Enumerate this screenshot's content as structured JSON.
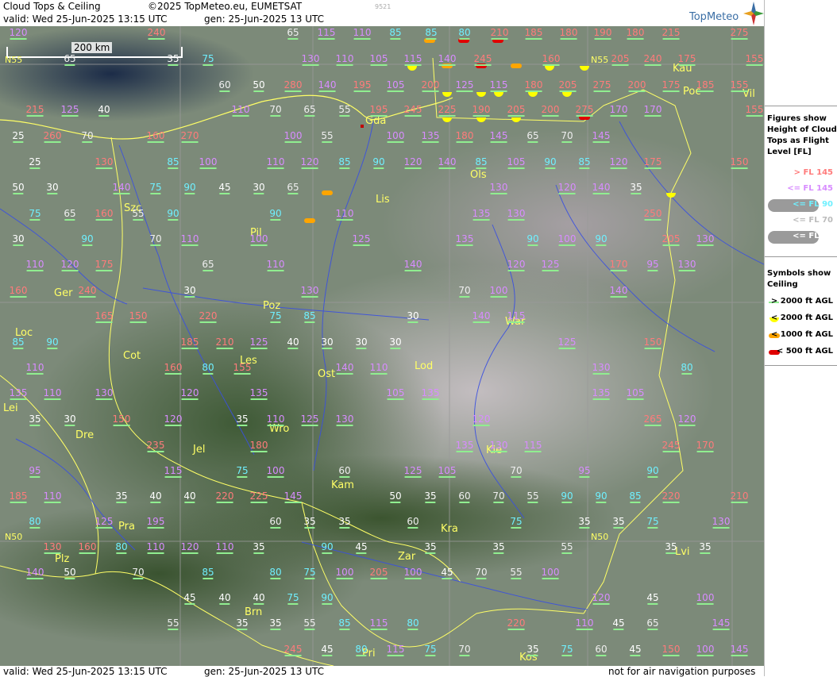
{
  "header": {
    "title": "Cloud Tops & Ceiling",
    "copyright": "©2025 TopMeteo.eu, EUMETSAT",
    "image_number": "9521",
    "valid": "valid:  Wed  25-Jun-2025  13:15 UTC",
    "generated": "gen:  25-Jun-2025 13 UTC",
    "logo": "TopMeteo"
  },
  "footer": {
    "valid": "valid:  Wed  25-Jun-2025  13:15 UTC",
    "generated": "gen:  25-Jun-2025 13 UTC",
    "disclaimer": "not for air navigation purposes"
  },
  "scale_bar": "200 km",
  "grid_labels": [
    "N55",
    "N55",
    "N50",
    "N50"
  ],
  "cities": [
    "Gda",
    "Kau",
    "Poc",
    "Vil",
    "Szc",
    "Ols",
    "Lis",
    "Pil",
    "Ger",
    "Poz",
    "War",
    "Loc",
    "Cot",
    "Les",
    "Ost",
    "Lod",
    "Lei",
    "Dre",
    "Wro",
    "Jel",
    "Kie",
    "Kam",
    "Pra",
    "Kra",
    "Zar",
    "Plz",
    "Lvi",
    "Brn",
    "Pri",
    "Kos"
  ],
  "flight_levels": [
    {
      "v": "120",
      "c": "mid"
    },
    {
      "v": "240",
      "c": "hi"
    },
    {
      "v": "65",
      "c": "vlo"
    },
    {
      "v": "115",
      "c": "mid"
    },
    {
      "v": "110",
      "c": "mid"
    },
    {
      "v": "85",
      "c": "lo"
    },
    {
      "v": "85",
      "c": "lo"
    },
    {
      "v": "80",
      "c": "lo"
    },
    {
      "v": "210",
      "c": "hi"
    },
    {
      "v": "185",
      "c": "hi"
    },
    {
      "v": "180",
      "c": "hi"
    },
    {
      "v": "190",
      "c": "hi"
    },
    {
      "v": "180",
      "c": "hi"
    },
    {
      "v": "215",
      "c": "hi"
    },
    {
      "v": "275",
      "c": "hi"
    },
    {
      "v": "65",
      "c": "vlo"
    },
    {
      "v": "35",
      "c": "min"
    },
    {
      "v": "75",
      "c": "lo"
    },
    {
      "v": "130",
      "c": "mid"
    },
    {
      "v": "110",
      "c": "mid"
    },
    {
      "v": "105",
      "c": "mid"
    },
    {
      "v": "115",
      "c": "mid"
    },
    {
      "v": "140",
      "c": "mid"
    },
    {
      "v": "245",
      "c": "hi"
    },
    {
      "v": "160",
      "c": "hi"
    },
    {
      "v": "205",
      "c": "hi"
    },
    {
      "v": "240",
      "c": "hi"
    },
    {
      "v": "175",
      "c": "hi"
    },
    {
      "v": "155",
      "c": "hi"
    },
    {
      "v": "60",
      "c": "vlo"
    },
    {
      "v": "50",
      "c": "min"
    },
    {
      "v": "280",
      "c": "hi"
    },
    {
      "v": "140",
      "c": "mid"
    },
    {
      "v": "195",
      "c": "hi"
    },
    {
      "v": "105",
      "c": "mid"
    },
    {
      "v": "200",
      "c": "hi"
    },
    {
      "v": "125",
      "c": "mid"
    },
    {
      "v": "115",
      "c": "mid"
    },
    {
      "v": "180",
      "c": "hi"
    },
    {
      "v": "205",
      "c": "hi"
    },
    {
      "v": "275",
      "c": "hi"
    },
    {
      "v": "200",
      "c": "hi"
    },
    {
      "v": "175",
      "c": "hi"
    },
    {
      "v": "185",
      "c": "hi"
    },
    {
      "v": "155",
      "c": "hi"
    },
    {
      "v": "215",
      "c": "hi"
    },
    {
      "v": "125",
      "c": "mid"
    },
    {
      "v": "40",
      "c": "min"
    },
    {
      "v": "110",
      "c": "mid"
    },
    {
      "v": "70",
      "c": "vlo"
    },
    {
      "v": "65",
      "c": "vlo"
    },
    {
      "v": "55",
      "c": "vlo"
    },
    {
      "v": "195",
      "c": "hi"
    },
    {
      "v": "245",
      "c": "hi"
    },
    {
      "v": "225",
      "c": "hi"
    },
    {
      "v": "190",
      "c": "hi"
    },
    {
      "v": "205",
      "c": "hi"
    },
    {
      "v": "200",
      "c": "hi"
    },
    {
      "v": "275",
      "c": "hi"
    },
    {
      "v": "170",
      "c": "mid"
    },
    {
      "v": "170",
      "c": "mid"
    },
    {
      "v": "155",
      "c": "hi"
    },
    {
      "v": "25",
      "c": "min"
    },
    {
      "v": "260",
      "c": "hi"
    },
    {
      "v": "70",
      "c": "vlo"
    },
    {
      "v": "160",
      "c": "hi"
    },
    {
      "v": "270",
      "c": "hi"
    },
    {
      "v": "100",
      "c": "mid"
    },
    {
      "v": "55",
      "c": "vlo"
    },
    {
      "v": "100",
      "c": "mid"
    },
    {
      "v": "135",
      "c": "mid"
    },
    {
      "v": "180",
      "c": "hi"
    },
    {
      "v": "145",
      "c": "mid"
    },
    {
      "v": "65",
      "c": "vlo"
    },
    {
      "v": "70",
      "c": "vlo"
    },
    {
      "v": "145",
      "c": "mid"
    },
    {
      "v": "25",
      "c": "min"
    },
    {
      "v": "130",
      "c": "hi"
    },
    {
      "v": "85",
      "c": "lo"
    },
    {
      "v": "100",
      "c": "mid"
    },
    {
      "v": "110",
      "c": "mid"
    },
    {
      "v": "120",
      "c": "mid"
    },
    {
      "v": "85",
      "c": "lo"
    },
    {
      "v": "90",
      "c": "lo"
    },
    {
      "v": "120",
      "c": "mid"
    },
    {
      "v": "140",
      "c": "mid"
    },
    {
      "v": "85",
      "c": "lo"
    },
    {
      "v": "105",
      "c": "mid"
    },
    {
      "v": "90",
      "c": "lo"
    },
    {
      "v": "85",
      "c": "lo"
    },
    {
      "v": "120",
      "c": "mid"
    },
    {
      "v": "175",
      "c": "hi"
    },
    {
      "v": "150",
      "c": "hi"
    },
    {
      "v": "50",
      "c": "min"
    },
    {
      "v": "30",
      "c": "min"
    },
    {
      "v": "140",
      "c": "mid"
    },
    {
      "v": "75",
      "c": "lo"
    },
    {
      "v": "90",
      "c": "lo"
    },
    {
      "v": "45",
      "c": "min"
    },
    {
      "v": "30",
      "c": "min"
    },
    {
      "v": "65",
      "c": "vlo"
    },
    {
      "v": "130",
      "c": "mid"
    },
    {
      "v": "120",
      "c": "mid"
    },
    {
      "v": "140",
      "c": "mid"
    },
    {
      "v": "35",
      "c": "min"
    },
    {
      "v": "75",
      "c": "lo"
    },
    {
      "v": "65",
      "c": "vlo"
    },
    {
      "v": "160",
      "c": "hi"
    },
    {
      "v": "55",
      "c": "vlo"
    },
    {
      "v": "90",
      "c": "lo"
    },
    {
      "v": "90",
      "c": "lo"
    },
    {
      "v": "110",
      "c": "mid"
    },
    {
      "v": "135",
      "c": "mid"
    },
    {
      "v": "130",
      "c": "mid"
    },
    {
      "v": "250",
      "c": "hi"
    },
    {
      "v": "30",
      "c": "min"
    },
    {
      "v": "90",
      "c": "lo"
    },
    {
      "v": "70",
      "c": "vlo"
    },
    {
      "v": "110",
      "c": "mid"
    },
    {
      "v": "100",
      "c": "mid"
    },
    {
      "v": "125",
      "c": "mid"
    },
    {
      "v": "135",
      "c": "mid"
    },
    {
      "v": "90",
      "c": "lo"
    },
    {
      "v": "100",
      "c": "mid"
    },
    {
      "v": "90",
      "c": "lo"
    },
    {
      "v": "205",
      "c": "hi"
    },
    {
      "v": "130",
      "c": "mid"
    },
    {
      "v": "110",
      "c": "mid"
    },
    {
      "v": "120",
      "c": "mid"
    },
    {
      "v": "175",
      "c": "hi"
    },
    {
      "v": "65",
      "c": "vlo"
    },
    {
      "v": "110",
      "c": "mid"
    },
    {
      "v": "140",
      "c": "mid"
    },
    {
      "v": "120",
      "c": "mid"
    },
    {
      "v": "125",
      "c": "mid"
    },
    {
      "v": "170",
      "c": "hi"
    },
    {
      "v": "95",
      "c": "mid"
    },
    {
      "v": "130",
      "c": "mid"
    },
    {
      "v": "160",
      "c": "hi"
    },
    {
      "v": "240",
      "c": "hi"
    },
    {
      "v": "30",
      "c": "min"
    },
    {
      "v": "130",
      "c": "mid"
    },
    {
      "v": "70",
      "c": "vlo"
    },
    {
      "v": "100",
      "c": "mid"
    },
    {
      "v": "140",
      "c": "mid"
    },
    {
      "v": "165",
      "c": "hi"
    },
    {
      "v": "150",
      "c": "hi"
    },
    {
      "v": "220",
      "c": "hi"
    },
    {
      "v": "75",
      "c": "lo"
    },
    {
      "v": "85",
      "c": "lo"
    },
    {
      "v": "30",
      "c": "min"
    },
    {
      "v": "140",
      "c": "mid"
    },
    {
      "v": "115",
      "c": "mid"
    },
    {
      "v": "85",
      "c": "lo"
    },
    {
      "v": "90",
      "c": "lo"
    },
    {
      "v": "185",
      "c": "hi"
    },
    {
      "v": "210",
      "c": "hi"
    },
    {
      "v": "125",
      "c": "mid"
    },
    {
      "v": "40",
      "c": "min"
    },
    {
      "v": "30",
      "c": "min"
    },
    {
      "v": "30",
      "c": "min"
    },
    {
      "v": "30",
      "c": "min"
    },
    {
      "v": "125",
      "c": "mid"
    },
    {
      "v": "150",
      "c": "hi"
    },
    {
      "v": "110",
      "c": "mid"
    },
    {
      "v": "160",
      "c": "hi"
    },
    {
      "v": "80",
      "c": "lo"
    },
    {
      "v": "155",
      "c": "hi"
    },
    {
      "v": "140",
      "c": "mid"
    },
    {
      "v": "110",
      "c": "mid"
    },
    {
      "v": "130",
      "c": "mid"
    },
    {
      "v": "80",
      "c": "lo"
    },
    {
      "v": "135",
      "c": "mid"
    },
    {
      "v": "110",
      "c": "mid"
    },
    {
      "v": "130",
      "c": "mid"
    },
    {
      "v": "120",
      "c": "mid"
    },
    {
      "v": "135",
      "c": "mid"
    },
    {
      "v": "105",
      "c": "mid"
    },
    {
      "v": "135",
      "c": "mid"
    },
    {
      "v": "135",
      "c": "mid"
    },
    {
      "v": "105",
      "c": "mid"
    },
    {
      "v": "35",
      "c": "min"
    },
    {
      "v": "30",
      "c": "min"
    },
    {
      "v": "150",
      "c": "hi"
    },
    {
      "v": "120",
      "c": "mid"
    },
    {
      "v": "35",
      "c": "min"
    },
    {
      "v": "110",
      "c": "mid"
    },
    {
      "v": "125",
      "c": "mid"
    },
    {
      "v": "130",
      "c": "mid"
    },
    {
      "v": "120",
      "c": "mid"
    },
    {
      "v": "265",
      "c": "hi"
    },
    {
      "v": "120",
      "c": "mid"
    },
    {
      "v": "235",
      "c": "hi"
    },
    {
      "v": "180",
      "c": "hi"
    },
    {
      "v": "135",
      "c": "mid"
    },
    {
      "v": "130",
      "c": "mid"
    },
    {
      "v": "115",
      "c": "mid"
    },
    {
      "v": "245",
      "c": "hi"
    },
    {
      "v": "170",
      "c": "hi"
    },
    {
      "v": "95",
      "c": "mid"
    },
    {
      "v": "115",
      "c": "mid"
    },
    {
      "v": "75",
      "c": "lo"
    },
    {
      "v": "100",
      "c": "mid"
    },
    {
      "v": "60",
      "c": "vlo"
    },
    {
      "v": "125",
      "c": "mid"
    },
    {
      "v": "105",
      "c": "mid"
    },
    {
      "v": "70",
      "c": "vlo"
    },
    {
      "v": "95",
      "c": "mid"
    },
    {
      "v": "90",
      "c": "lo"
    },
    {
      "v": "185",
      "c": "hi"
    },
    {
      "v": "110",
      "c": "mid"
    },
    {
      "v": "35",
      "c": "min"
    },
    {
      "v": "40",
      "c": "min"
    },
    {
      "v": "40",
      "c": "min"
    },
    {
      "v": "220",
      "c": "hi"
    },
    {
      "v": "225",
      "c": "hi"
    },
    {
      "v": "145",
      "c": "mid"
    },
    {
      "v": "50",
      "c": "min"
    },
    {
      "v": "35",
      "c": "min"
    },
    {
      "v": "60",
      "c": "vlo"
    },
    {
      "v": "70",
      "c": "vlo"
    },
    {
      "v": "55",
      "c": "vlo"
    },
    {
      "v": "90",
      "c": "lo"
    },
    {
      "v": "90",
      "c": "lo"
    },
    {
      "v": "85",
      "c": "lo"
    },
    {
      "v": "220",
      "c": "hi"
    },
    {
      "v": "210",
      "c": "hi"
    },
    {
      "v": "80",
      "c": "lo"
    },
    {
      "v": "125",
      "c": "mid"
    },
    {
      "v": "195",
      "c": "mid"
    },
    {
      "v": "60",
      "c": "vlo"
    },
    {
      "v": "35",
      "c": "min"
    },
    {
      "v": "35",
      "c": "min"
    },
    {
      "v": "60",
      "c": "vlo"
    },
    {
      "v": "75",
      "c": "lo"
    },
    {
      "v": "35",
      "c": "min"
    },
    {
      "v": "35",
      "c": "min"
    },
    {
      "v": "75",
      "c": "lo"
    },
    {
      "v": "130",
      "c": "mid"
    },
    {
      "v": "130",
      "c": "hi"
    },
    {
      "v": "160",
      "c": "hi"
    },
    {
      "v": "80",
      "c": "lo"
    },
    {
      "v": "110",
      "c": "mid"
    },
    {
      "v": "120",
      "c": "mid"
    },
    {
      "v": "110",
      "c": "mid"
    },
    {
      "v": "35",
      "c": "min"
    },
    {
      "v": "90",
      "c": "lo"
    },
    {
      "v": "45",
      "c": "min"
    },
    {
      "v": "35",
      "c": "min"
    },
    {
      "v": "35",
      "c": "min"
    },
    {
      "v": "55",
      "c": "vlo"
    },
    {
      "v": "35",
      "c": "min"
    },
    {
      "v": "35",
      "c": "min"
    },
    {
      "v": "140",
      "c": "mid"
    },
    {
      "v": "50",
      "c": "min"
    },
    {
      "v": "70",
      "c": "vlo"
    },
    {
      "v": "85",
      "c": "lo"
    },
    {
      "v": "80",
      "c": "lo"
    },
    {
      "v": "75",
      "c": "lo"
    },
    {
      "v": "100",
      "c": "mid"
    },
    {
      "v": "205",
      "c": "hi"
    },
    {
      "v": "100",
      "c": "mid"
    },
    {
      "v": "45",
      "c": "min"
    },
    {
      "v": "70",
      "c": "vlo"
    },
    {
      "v": "55",
      "c": "vlo"
    },
    {
      "v": "100",
      "c": "mid"
    },
    {
      "v": "45",
      "c": "min"
    },
    {
      "v": "40",
      "c": "min"
    },
    {
      "v": "40",
      "c": "min"
    },
    {
      "v": "75",
      "c": "lo"
    },
    {
      "v": "90",
      "c": "lo"
    },
    {
      "v": "120",
      "c": "mid"
    },
    {
      "v": "45",
      "c": "min"
    },
    {
      "v": "100",
      "c": "mid"
    },
    {
      "v": "55",
      "c": "vlo"
    },
    {
      "v": "35",
      "c": "min"
    },
    {
      "v": "35",
      "c": "min"
    },
    {
      "v": "55",
      "c": "vlo"
    },
    {
      "v": "85",
      "c": "lo"
    },
    {
      "v": "115",
      "c": "mid"
    },
    {
      "v": "80",
      "c": "lo"
    },
    {
      "v": "220",
      "c": "hi"
    },
    {
      "v": "110",
      "c": "mid"
    },
    {
      "v": "45",
      "c": "min"
    },
    {
      "v": "65",
      "c": "vlo"
    },
    {
      "v": "145",
      "c": "mid"
    },
    {
      "v": "245",
      "c": "hi"
    },
    {
      "v": "45",
      "c": "min"
    },
    {
      "v": "80",
      "c": "lo"
    },
    {
      "v": "115",
      "c": "mid"
    },
    {
      "v": "75",
      "c": "lo"
    },
    {
      "v": "70",
      "c": "vlo"
    },
    {
      "v": "35",
      "c": "min"
    },
    {
      "v": "75",
      "c": "lo"
    },
    {
      "v": "60",
      "c": "vlo"
    },
    {
      "v": "45",
      "c": "min"
    },
    {
      "v": "150",
      "c": "hi"
    },
    {
      "v": "100",
      "c": "mid"
    },
    {
      "v": "145",
      "c": "mid"
    }
  ],
  "ceiling_symbols": [
    {
      "type": "1000"
    },
    {
      "type": "500"
    },
    {
      "type": "500"
    },
    {
      "type": "2000"
    },
    {
      "type": "1000"
    },
    {
      "type": "500"
    },
    {
      "type": "1000"
    },
    {
      "type": "2000"
    },
    {
      "type": "2000"
    },
    {
      "type": "2000"
    },
    {
      "type": "2000"
    },
    {
      "type": "2000"
    },
    {
      "type": "2000"
    },
    {
      "type": "2000"
    },
    {
      "type": "2000"
    },
    {
      "type": "2000"
    },
    {
      "type": "2000"
    },
    {
      "type": "500"
    },
    {
      "type": "1000"
    },
    {
      "type": "1000"
    },
    {
      "type": "2000"
    }
  ],
  "legend": {
    "fl_heading": "Figures show Height of Cloud Tops as Flight Level  [FL]",
    "fl_rows": [
      {
        "label": "> FL 145",
        "color": "#ff7b7b",
        "pill": ""
      },
      {
        "label": "<= FL 145",
        "color": "#d88cff",
        "pill": ""
      },
      {
        "label": "<= FL 90",
        "color": "#6ff0ff",
        "pill": "#9a9a9a"
      },
      {
        "label": "<= FL 70",
        "color": "#bbbbbb",
        "pill": ""
      },
      {
        "label": "<= FL 50",
        "color": "#ffffff",
        "pill": "#9a9a9a"
      }
    ],
    "ceil_heading": "Symbols show Ceiling",
    "ceil_rows": [
      {
        "label": "> 2000 ft AGL",
        "color": "#90ee90"
      },
      {
        "label": "< 2000 ft AGL",
        "color": "#ffff00"
      },
      {
        "label": "< 1000 ft AGL",
        "color": "#ffa500"
      },
      {
        "label": "< 500 ft AGL",
        "color": "#e00000"
      }
    ]
  }
}
